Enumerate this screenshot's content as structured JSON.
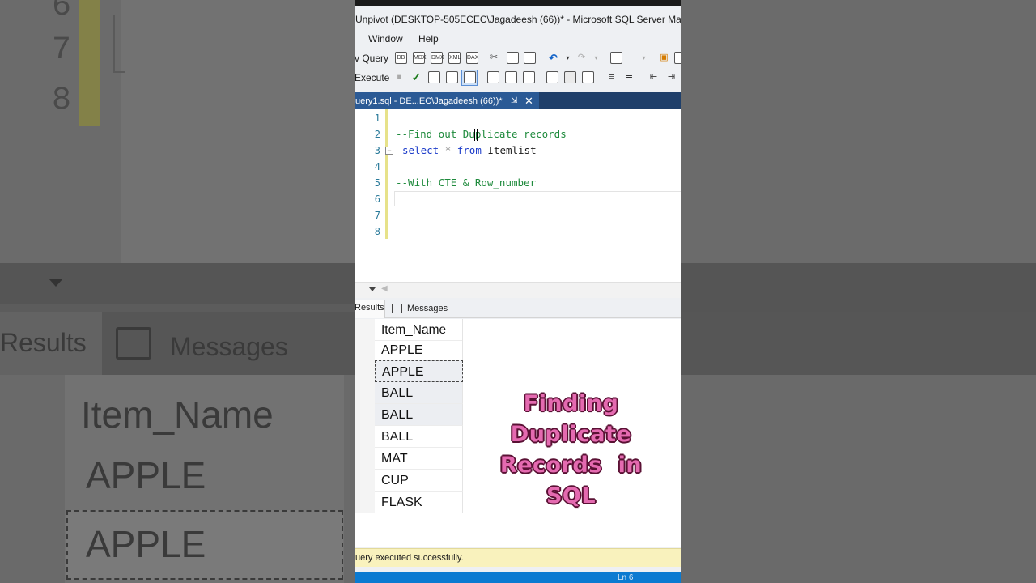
{
  "window": {
    "title": "Unpivot (DESKTOP-505ECEC\\Jagadeesh (66))* - Microsoft SQL Server Manage"
  },
  "menu": {
    "items": [
      "Window",
      "Help"
    ]
  },
  "toolbar": {
    "new_query_label": "v Query",
    "execute_label": "Execute"
  },
  "document_tab": {
    "label": "uery1.sql - DE...EC\\Jagadeesh (66))*",
    "pin_icon": "pin-icon",
    "close_icon": "close-icon"
  },
  "editor": {
    "line_numbers": [
      "1",
      "2",
      "3",
      "4",
      "5",
      "6",
      "7",
      "8"
    ],
    "line2_comment": "--Find out Duplicate records",
    "line3_select": "select",
    "line3_star": "*",
    "line3_from": "from",
    "line3_table": "Itemlist",
    "line5_comment": "--With CTE & Row_number",
    "fold_symbol": "−"
  },
  "results_tabs": {
    "results_label": "Results",
    "messages_label": "Messages"
  },
  "grid": {
    "column_header": "Item_Name",
    "rows": [
      "APPLE",
      "APPLE",
      "BALL",
      "BALL",
      "BALL",
      "MAT",
      "CUP",
      "FLASK"
    ]
  },
  "overlay": {
    "line1": "Finding",
    "line2": "Duplicate",
    "line3": "Records  in",
    "line4": "SQL",
    "fill_color": "#e46ab0",
    "outline_color": "#5a1134"
  },
  "status": {
    "message": "uery executed successfully.",
    "position": "Ln 6"
  },
  "blurred_left": {
    "line_numbers": [
      "6",
      "7",
      "8"
    ],
    "results_label": "Results",
    "messages_label": "Messages",
    "column_header": "Item_Name",
    "rows": [
      "APPLE",
      "APPLE"
    ]
  },
  "colors": {
    "accent_blue": "#0b7ad1",
    "tab_blue": "#2b5a95",
    "comment_green": "#1e8a3c",
    "keyword_blue": "#1a3ac9"
  }
}
